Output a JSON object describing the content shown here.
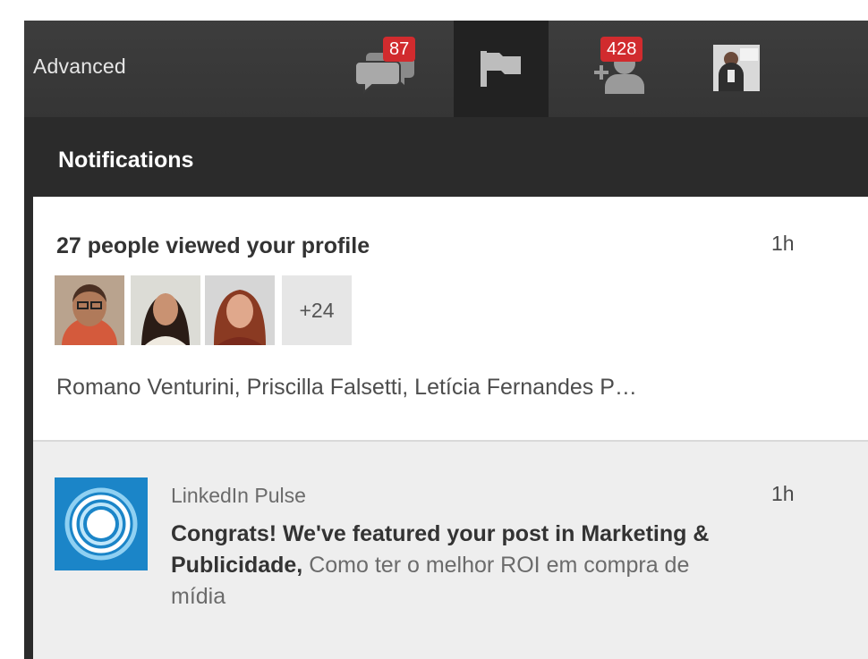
{
  "topbar": {
    "advanced_label": "Advanced",
    "messages_badge": "87",
    "connections_badge": "428",
    "icons": [
      "messages-icon",
      "flag-icon",
      "add-connection-icon",
      "profile-avatar"
    ]
  },
  "notifications": {
    "title": "Notifications",
    "items": [
      {
        "headline": "27 people viewed your profile",
        "time": "1h",
        "more_count": "+24",
        "names": "Romano Venturini, Priscilla Falsetti, Letícia Fernandes P…"
      },
      {
        "source": "LinkedIn Pulse",
        "time": "1h",
        "bold_text": "Congrats! We've featured your post in Marketing & Publicidade,",
        "article_text": "Como ter o melhor ROI em compra de mídia"
      }
    ]
  },
  "colors": {
    "topbar": "#3a3a3a",
    "header": "#2b2b2b",
    "badge": "#d12b2e",
    "pulse_blue": "#1b85c8",
    "item_highlight": "#eeeeee"
  }
}
